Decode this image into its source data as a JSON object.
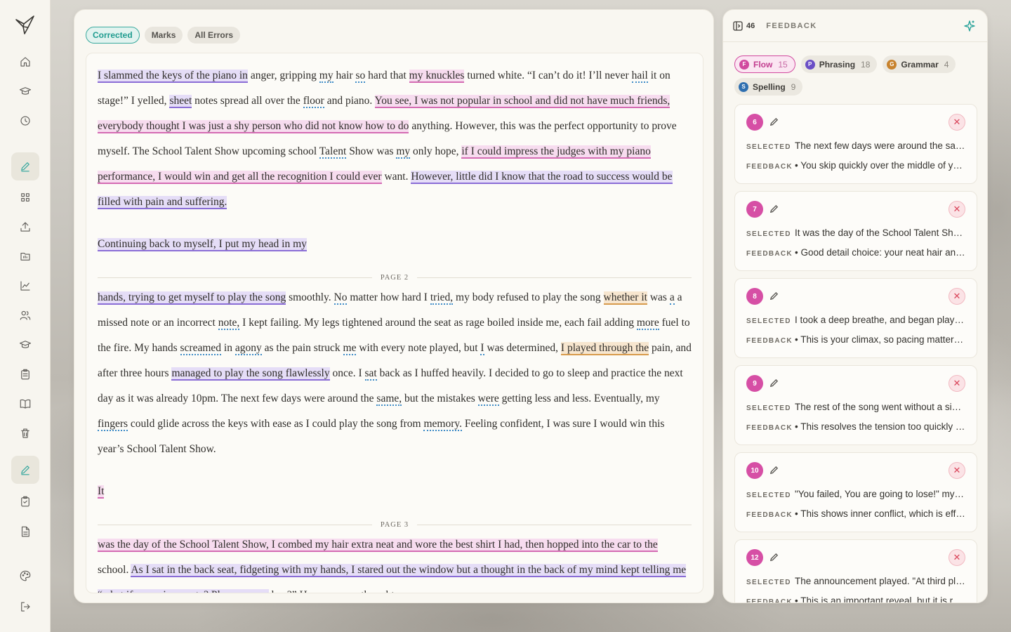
{
  "sidebar": {
    "items": [
      "home",
      "learn",
      "history",
      "write",
      "dashboard",
      "upload",
      "folder",
      "analytics",
      "people",
      "courses",
      "clipboard",
      "book",
      "trash",
      "write-active",
      "checklist",
      "document",
      "palette",
      "logout"
    ]
  },
  "editor": {
    "tabs": [
      {
        "label": "Corrected",
        "active": true
      },
      {
        "label": "Marks",
        "active": false
      },
      {
        "label": "All Errors",
        "active": false
      }
    ],
    "page2_label": "PAGE 2",
    "page3_label": "PAGE 3"
  },
  "feedback": {
    "count": "46",
    "title": "FEEDBACK",
    "chips": [
      {
        "label": "Flow",
        "count": "15",
        "color": "#d14a9f",
        "icon": "F"
      },
      {
        "label": "Phrasing",
        "count": "18",
        "color": "#6a4fc6",
        "icon": "P"
      },
      {
        "label": "Grammar",
        "count": "4",
        "color": "#c8832e",
        "icon": "G"
      },
      {
        "label": "Spelling",
        "count": "9",
        "color": "#2f6fb0",
        "icon": "S"
      }
    ],
    "selected_label": "SELECTED",
    "feedback_label": "FEEDBACK",
    "cards": [
      {
        "num": "6",
        "selected": "The next few days were around the same, but the mistakes were getting less and less.",
        "feedback": "• You skip quickly over the middle of your story here."
      },
      {
        "num": "7",
        "selected": "It was the day of the School Talent Show, I combed my hair extra neat",
        "feedback": "• Good detail choice: your neat hair and best shirt show preparation."
      },
      {
        "num": "8",
        "selected": "I took a deep breathe, and began playing the song",
        "feedback": "• This is your climax, so pacing matters here."
      },
      {
        "num": "9",
        "selected": "The rest of the song went without a single mistake",
        "feedback": "• This resolves the tension too quickly for the reader."
      },
      {
        "num": "10",
        "selected": "\"You failed, You are going to lose!\" my mind said",
        "feedback": "• This shows inner conflict, which is effective."
      },
      {
        "num": "12",
        "selected": "The announcement played. \"At third place...\"",
        "feedback": "• This is an important reveal, but it is rushed."
      }
    ]
  }
}
